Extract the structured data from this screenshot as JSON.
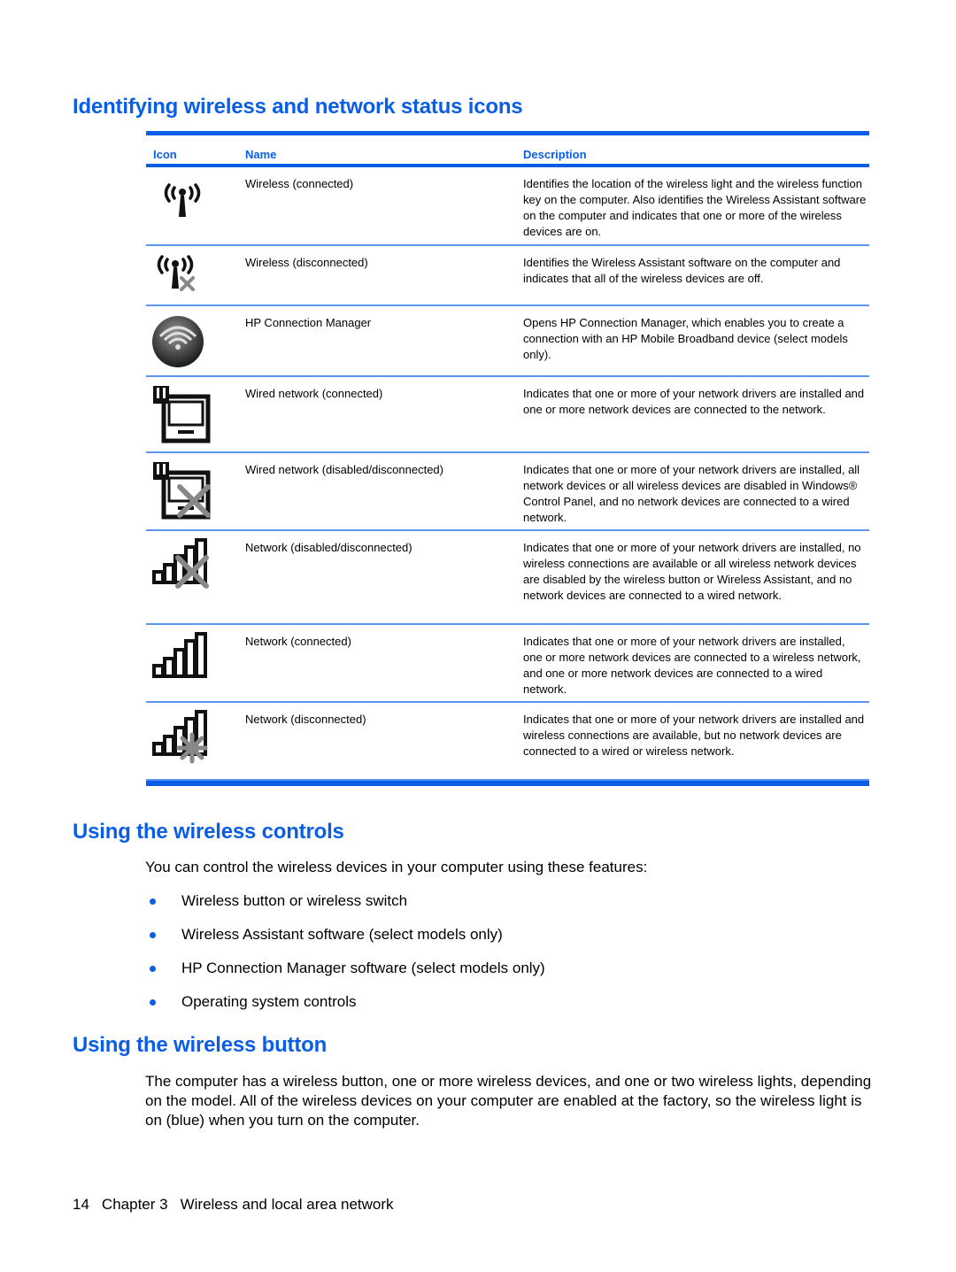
{
  "sections": {
    "icons_heading": "Identifying wireless and network status icons",
    "controls_heading": "Using the wireless controls",
    "button_heading": "Using the wireless button"
  },
  "table": {
    "headers": {
      "icon": "Icon",
      "name": "Name",
      "description": "Description"
    },
    "accent_color": "#0a5ee6",
    "rows": [
      {
        "icon": "wireless-connected-icon",
        "name": "Wireless (connected)",
        "description": "Identifies the location of the wireless light and the wireless function key on the computer. Also identifies the Wireless Assistant software on the computer and indicates that one or more of the wireless devices are on."
      },
      {
        "icon": "wireless-disconnected-icon",
        "name": "Wireless (disconnected)",
        "description": "Identifies the Wireless Assistant software on the computer and indicates that all of the wireless devices are off."
      },
      {
        "icon": "hp-connection-manager-icon",
        "name": "HP Connection Manager",
        "description": "Opens HP Connection Manager, which enables you to create a connection with an HP Mobile Broadband device (select models only)."
      },
      {
        "icon": "wired-network-connected-icon",
        "name": "Wired network (connected)",
        "description": "Indicates that one or more of your network drivers are installed and one or more network devices are connected to the network."
      },
      {
        "icon": "wired-network-disconnected-icon",
        "name": "Wired network (disabled/disconnected)",
        "description": "Indicates that one or more of your network drivers are installed, all network devices or all wireless devices are disabled in Windows® Control Panel, and no network devices are connected to a wired network."
      },
      {
        "icon": "network-disabled-icon",
        "name": "Network (disabled/disconnected)",
        "description": "Indicates that one or more of your network drivers are installed, no wireless connections are available or all wireless network devices are disabled by the wireless button or Wireless Assistant, and no network devices are connected to a wired network."
      },
      {
        "icon": "network-connected-icon",
        "name": "Network (connected)",
        "description": "Indicates that one or more of your network drivers are installed, one or more network devices are connected to a wireless network, and one or more network devices are connected to a wired network."
      },
      {
        "icon": "network-disconnected-icon",
        "name": "Network (disconnected)",
        "description": "Indicates that one or more of your network drivers are installed and wireless connections are available, but no network devices are connected to a wired or wireless network."
      }
    ]
  },
  "controls": {
    "intro": "You can control the wireless devices in your computer using these features:",
    "bullets": [
      "Wireless button or wireless switch",
      "Wireless Assistant software (select models only)",
      "HP Connection Manager software (select models only)",
      "Operating system controls"
    ]
  },
  "button_section": {
    "paragraph": "The computer has a wireless button, one or more wireless devices, and one or two wireless lights, depending on the model. All of the wireless devices on your computer are enabled at the factory, so the wireless light is on (blue) when you turn on the computer."
  },
  "footer": {
    "page_number": "14",
    "chapter": "Chapter 3",
    "chapter_title": "Wireless and local area network"
  }
}
